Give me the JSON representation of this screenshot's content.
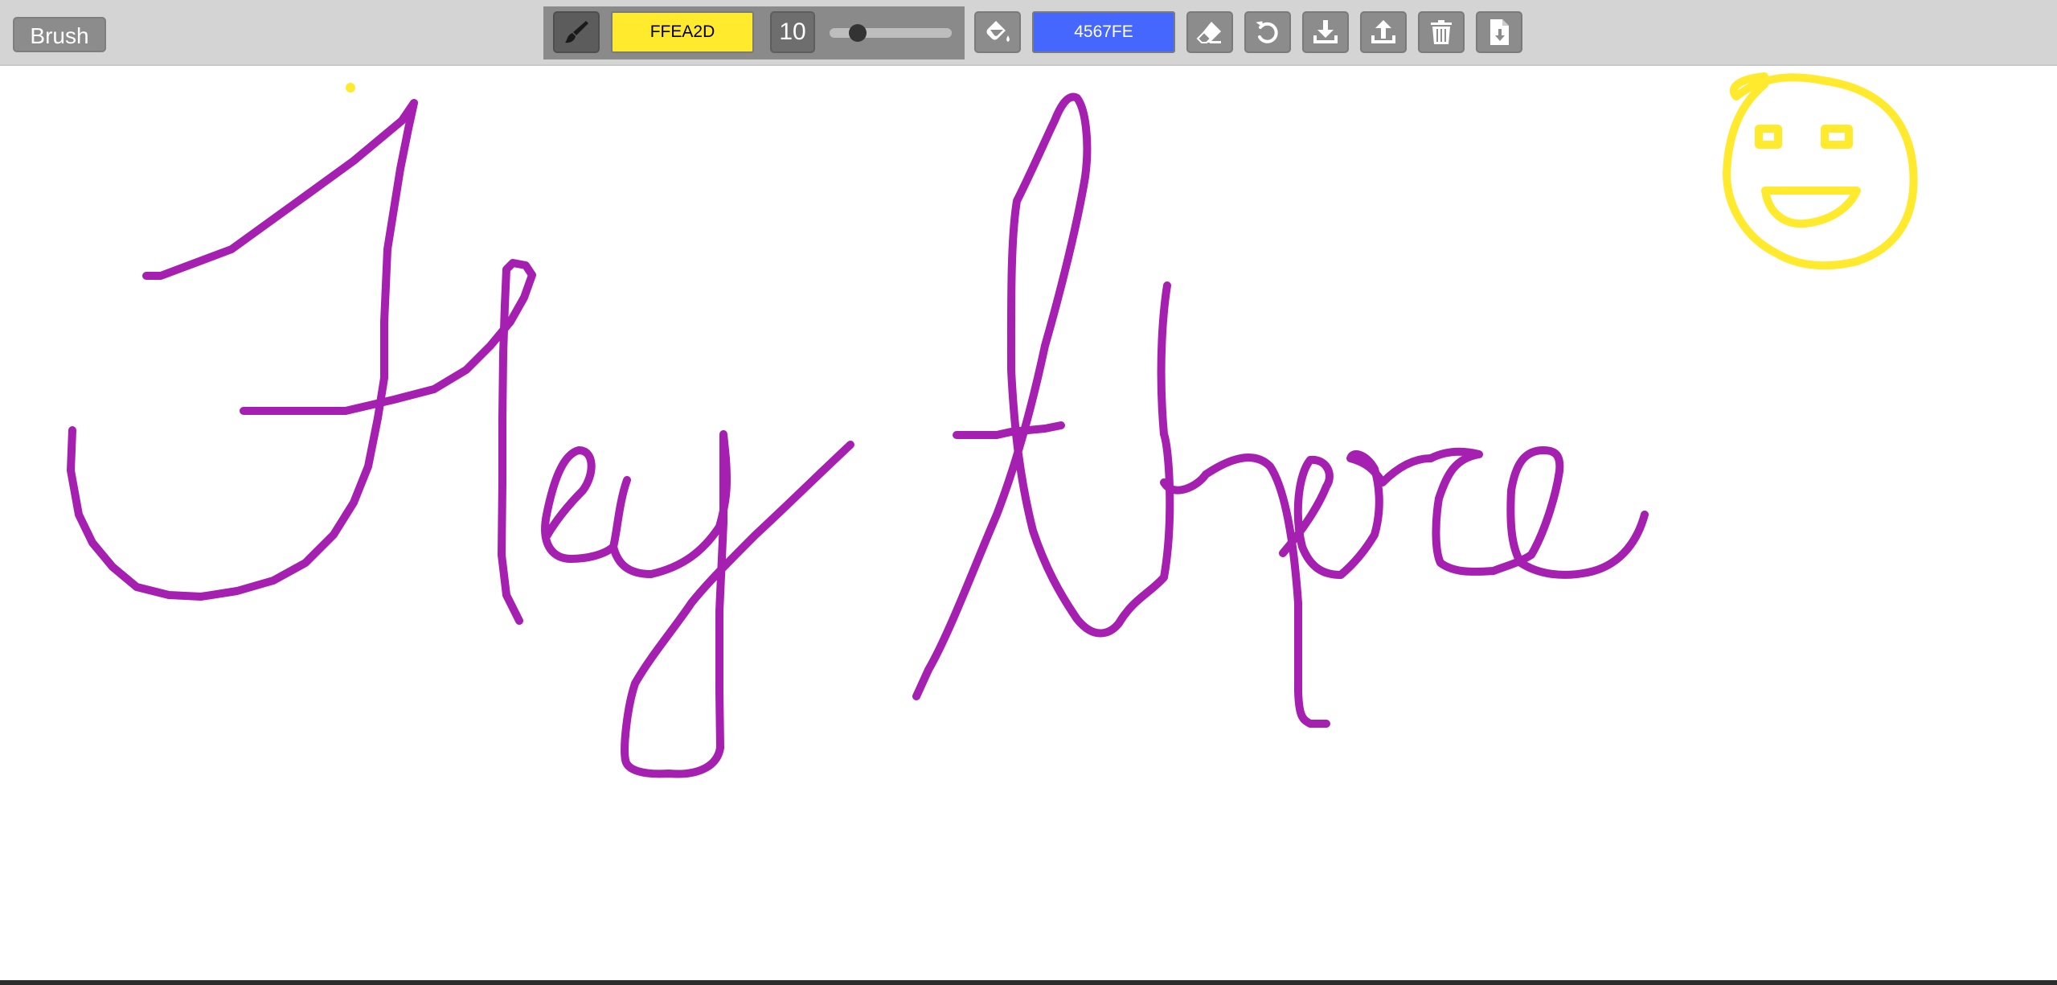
{
  "toolbar": {
    "mode_label": "Brush",
    "brush_color": {
      "label": "FFEA2D",
      "hex": "#FFEA2D"
    },
    "brush_size": "10",
    "brush_size_slider": {
      "min": 1,
      "max": 50,
      "value": 10
    },
    "fill_color": {
      "label": "4567FE",
      "hex": "#4567FE"
    },
    "icons": [
      "brush-icon",
      "paint-bucket-icon",
      "eraser-icon",
      "undo-icon",
      "download-icon",
      "upload-icon",
      "trash-icon",
      "save-file-icon"
    ]
  },
  "canvas": {
    "stroke_colors": {
      "handwriting": "#A51FB0",
      "smiley": "#FFEA2D"
    }
  }
}
